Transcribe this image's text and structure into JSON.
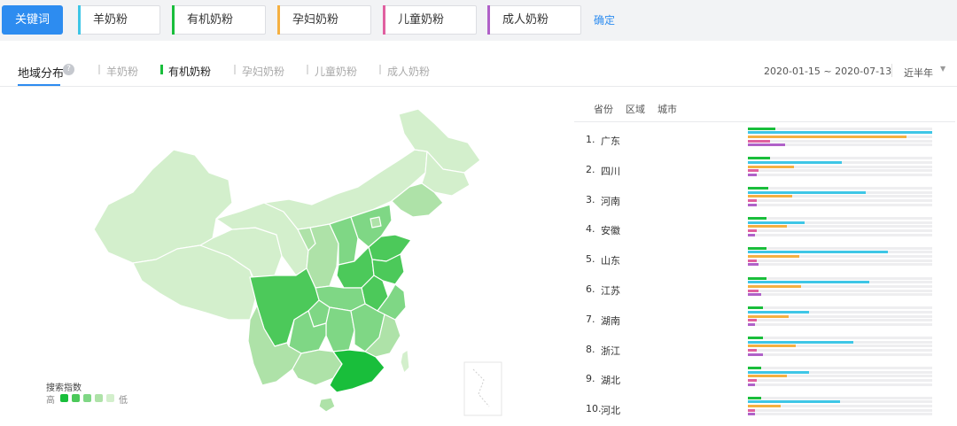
{
  "keyword_bar": {
    "button_label": "关键词",
    "chips": [
      {
        "label": "羊奶粉",
        "color": "#3ec6e6"
      },
      {
        "label": "有机奶粉",
        "color": "#19be3b"
      },
      {
        "label": "孕妇奶粉",
        "color": "#f5b041"
      },
      {
        "label": "儿童奶粉",
        "color": "#e060a0"
      },
      {
        "label": "成人奶粉",
        "color": "#b061c8"
      }
    ],
    "confirm_label": "确定"
  },
  "tabs": {
    "main_label": "地域分布",
    "help_glyph": "?",
    "items": [
      {
        "label": "羊奶粉",
        "active": false
      },
      {
        "label": "有机奶粉",
        "active": true
      },
      {
        "label": "孕妇奶粉",
        "active": false
      },
      {
        "label": "儿童奶粉",
        "active": false
      },
      {
        "label": "成人奶粉",
        "active": false
      }
    ],
    "date_range": "2020-01-15 ~ 2020-07-13",
    "period": "近半年"
  },
  "legend": {
    "title": "搜索指数",
    "high": "高",
    "low": "低",
    "colors": [
      "#19be3b",
      "#4cc95a",
      "#7fd785",
      "#aee2a8",
      "#d3efcc"
    ]
  },
  "ranking": {
    "tabs": [
      "省份",
      "区域",
      "城市"
    ],
    "series_colors": [
      "#19be3b",
      "#3ec6e6",
      "#f5b041",
      "#e060a0",
      "#b061c8"
    ],
    "rows": [
      {
        "rank": "1.",
        "name": "广东",
        "values": [
          0.15,
          1.0,
          0.86,
          0.12,
          0.2
        ]
      },
      {
        "rank": "2.",
        "name": "四川",
        "values": [
          0.12,
          0.51,
          0.25,
          0.06,
          0.05
        ]
      },
      {
        "rank": "3.",
        "name": "河南",
        "values": [
          0.11,
          0.64,
          0.24,
          0.05,
          0.05
        ]
      },
      {
        "rank": "4.",
        "name": "安徽",
        "values": [
          0.1,
          0.31,
          0.21,
          0.05,
          0.04
        ]
      },
      {
        "rank": "5.",
        "name": "山东",
        "values": [
          0.1,
          0.76,
          0.28,
          0.05,
          0.06
        ]
      },
      {
        "rank": "6.",
        "name": "江苏",
        "values": [
          0.1,
          0.66,
          0.29,
          0.06,
          0.07
        ]
      },
      {
        "rank": "7.",
        "name": "湖南",
        "values": [
          0.08,
          0.33,
          0.22,
          0.05,
          0.04
        ]
      },
      {
        "rank": "8.",
        "name": "浙江",
        "values": [
          0.08,
          0.57,
          0.26,
          0.05,
          0.08
        ]
      },
      {
        "rank": "9.",
        "name": "湖北",
        "values": [
          0.07,
          0.33,
          0.21,
          0.05,
          0.04
        ]
      },
      {
        "rank": "10.",
        "name": "河北",
        "values": [
          0.07,
          0.5,
          0.18,
          0.04,
          0.04
        ]
      }
    ]
  }
}
